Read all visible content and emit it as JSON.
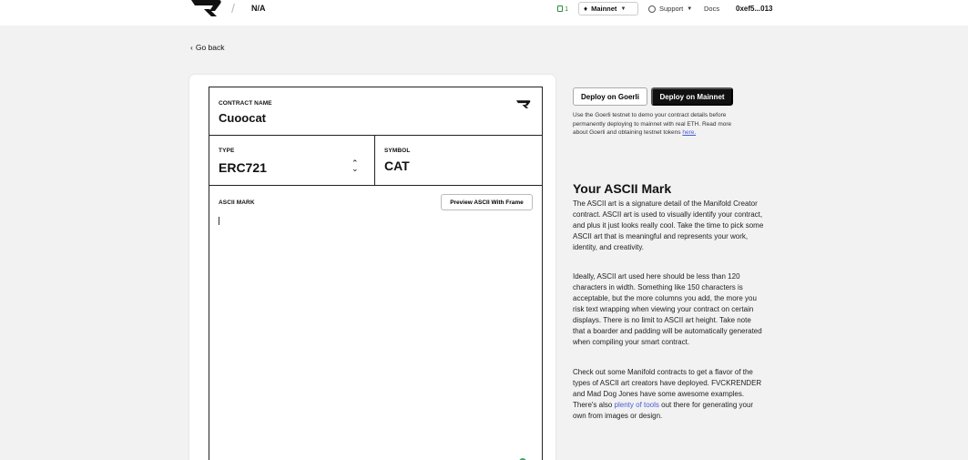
{
  "header": {
    "project_name": "N/A",
    "tx_count": "1",
    "network": "Mainnet",
    "support_label": "Support",
    "docs_label": "Docs",
    "wallet_address": "0xef5...013"
  },
  "back_label": "Go back",
  "form": {
    "contract_name_label": "CONTRACT NAME",
    "contract_name_value": "Cuoocat",
    "type_label": "TYPE",
    "type_value": "ERC721",
    "symbol_label": "SYMBOL",
    "symbol_value": "CAT",
    "ascii_label": "ASCII MARK",
    "preview_button": "Preview ASCII With Frame",
    "ascii_value": ""
  },
  "deploy": {
    "goerli_button": "Deploy on Goerli",
    "mainnet_button": "Deploy on Mainnet",
    "note_text": "Use the Goerli testnet to demo your contract details before permanently deploying to mainnet with real ETH. Read more about Goerli and obtaining testnet tokens ",
    "note_link": "here."
  },
  "info": {
    "title": "Your ASCII Mark",
    "para1": "The ASCII art is a signature detail of the Manifold Creator contract. ASCII art is used to visually identify your contract, and plus it just looks really cool. Take the time to pick some ASCII art that is meaningful and represents your work, identity, and creativity.",
    "para2": "Ideally, ASCII art used here should be less than 120 characters in width. Something like 150 characters is acceptable, but the more columns you add, the more you risk text wrapping when viewing your contract on certain displays. There is no limit to ASCII art height. Take note that a boarder and padding will be automatically generated when compiling your smart contract.",
    "para3_a": "Check out some Manifold contracts to get a flavor of the types of ASCII art creators have deployed. FVCKRENDER and Mad Dog Jones have some awesome examples. There's also ",
    "para3_link": "plenty of tools",
    "para3_b": " out there for generating your own from images or design."
  },
  "icons": {
    "logo": "manifold-logo-icon",
    "eth": "ethereum-icon",
    "globe": "globe-icon",
    "chevron": "chevron-down-icon",
    "updown": "select-updown-icon"
  },
  "colors": {
    "accent_link": "#4a5bd4",
    "tx_green": "#2e8b3a",
    "primary_button": "#111111"
  }
}
